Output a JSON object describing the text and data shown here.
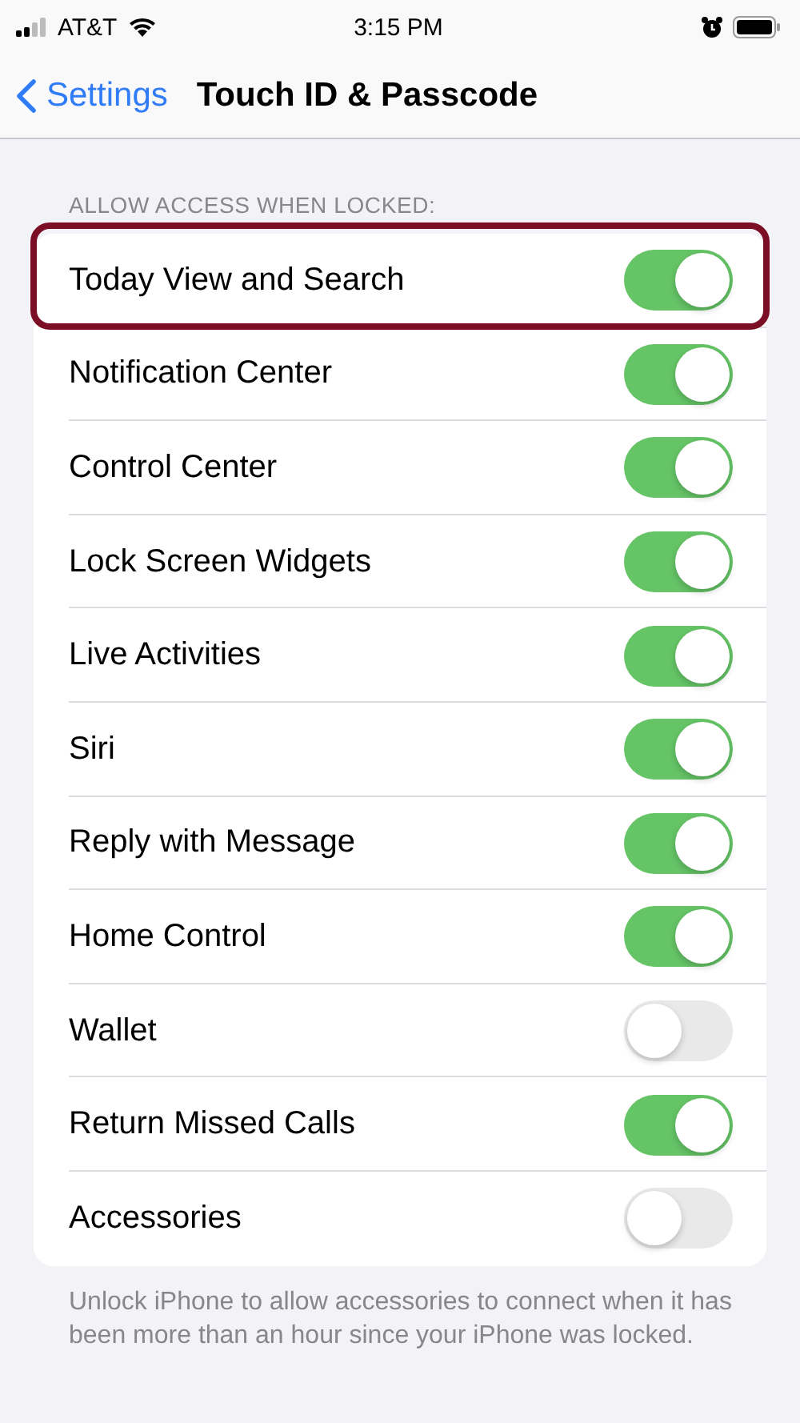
{
  "status_bar": {
    "carrier": "AT&T",
    "time": "3:15 PM"
  },
  "nav": {
    "back_label": "Settings",
    "title": "Touch ID & Passcode"
  },
  "section": {
    "header": "ALLOW ACCESS WHEN LOCKED:",
    "items": [
      {
        "label": "Today View and Search",
        "on": true,
        "highlighted": true
      },
      {
        "label": "Notification Center",
        "on": true,
        "highlighted": false
      },
      {
        "label": "Control Center",
        "on": true,
        "highlighted": false
      },
      {
        "label": "Lock Screen Widgets",
        "on": true,
        "highlighted": false
      },
      {
        "label": "Live Activities",
        "on": true,
        "highlighted": false
      },
      {
        "label": "Siri",
        "on": true,
        "highlighted": false
      },
      {
        "label": "Reply with Message",
        "on": true,
        "highlighted": false
      },
      {
        "label": "Home Control",
        "on": true,
        "highlighted": false
      },
      {
        "label": "Wallet",
        "on": false,
        "highlighted": false
      },
      {
        "label": "Return Missed Calls",
        "on": true,
        "highlighted": false
      },
      {
        "label": "Accessories",
        "on": false,
        "highlighted": false
      }
    ],
    "footer": "Unlock iPhone to allow accessories to connect when it has been more than an hour since your iPhone was locked."
  }
}
